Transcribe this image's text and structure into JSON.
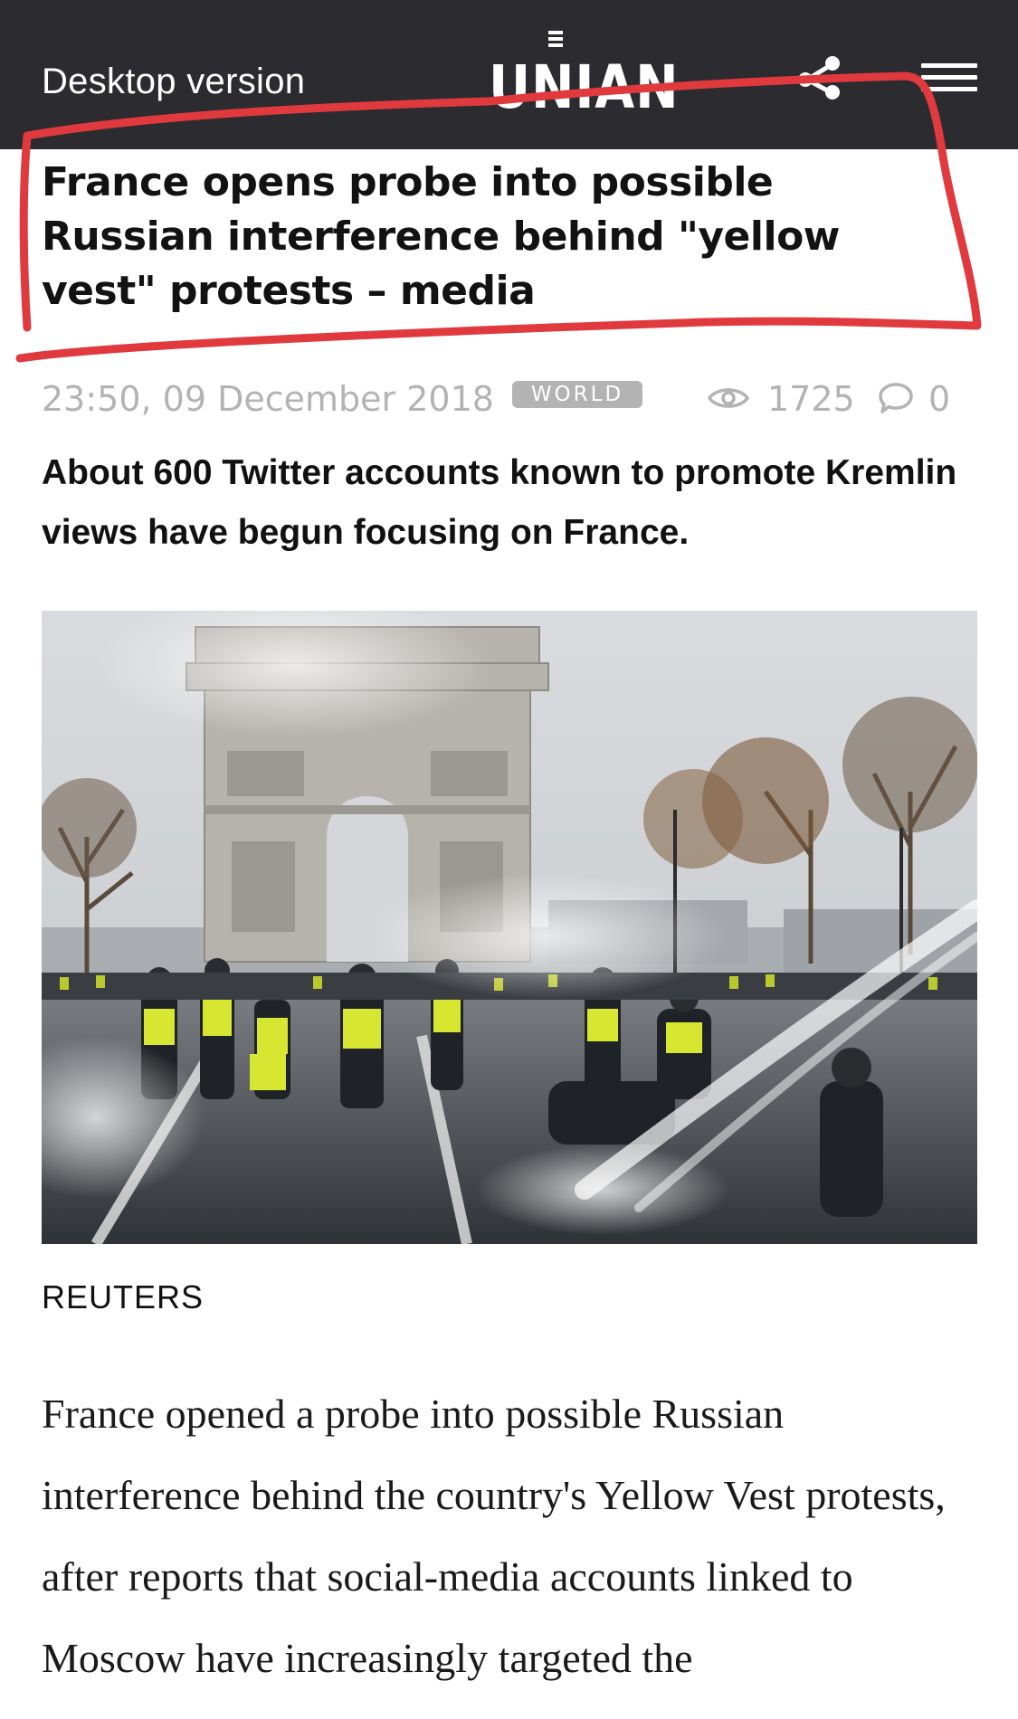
{
  "header": {
    "desktop_link": "Desktop version",
    "logo_text": "UNIAN",
    "share_icon": "share-icon",
    "menu_icon": "hamburger-menu-icon",
    "background_color": "#2c2c30"
  },
  "article": {
    "headline": "France opens probe into possible Russian interference behind \"yellow vest\" protests – media",
    "date": "23:50, 09 December 2018",
    "category": "WORLD",
    "views": "1725",
    "comments": "0",
    "lead": "About 600 Twitter accounts known to promote Kremlin views have begun focusing on France.",
    "image_credit": "REUTERS",
    "body": "France opened a probe into possible Russian interference behind the country's Yellow Vest protests, after reports that social-media accounts linked to Moscow have increasingly targeted the"
  },
  "annotation": {
    "color": "#e0393e"
  }
}
